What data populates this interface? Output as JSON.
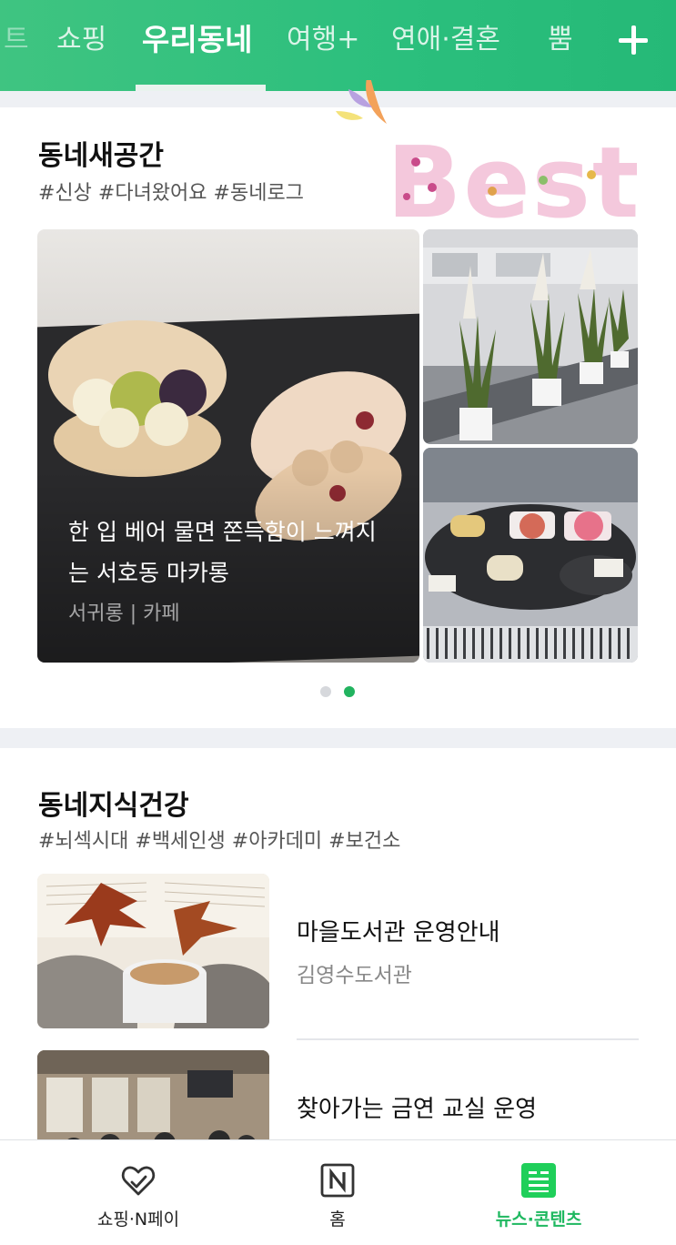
{
  "colors": {
    "brand_green": "#2bbf7d",
    "active_green": "#1fb860",
    "dot_inactive": "#d6d8dc"
  },
  "top_tabs": [
    {
      "label": "트",
      "state": "partial"
    },
    {
      "label": "쇼핑",
      "state": "normal"
    },
    {
      "label": "우리동네",
      "state": "active"
    },
    {
      "label": "여행+",
      "state": "normal"
    },
    {
      "label": "연애·결혼",
      "state": "normal"
    },
    {
      "label": "뿜",
      "state": "normal"
    }
  ],
  "top_plus_icon": "plus-icon",
  "sticker": {
    "text": "Best"
  },
  "section1": {
    "title": "동네새공간",
    "tags": "#신상 #다녀왔어요 #동네로그",
    "feature": {
      "caption": "한 입 베어 물면 쫀득함이 느껴지는 서호동 마카롱",
      "meta": "서귀롱 | 카페"
    },
    "carousel": {
      "total": 2,
      "active": 2
    }
  },
  "section2": {
    "title": "동네지식건강",
    "tags": "#뇌섹시대 #백세인생 #아카데미 #보건소",
    "items": [
      {
        "title": "마을도서관 운영안내",
        "source": "김영수도서관"
      },
      {
        "title": "찾아가는 금연 교실 운영"
      }
    ]
  },
  "bottom_nav": [
    {
      "label": "쇼핑·N페이",
      "icon": "heart-check-icon",
      "active": false
    },
    {
      "label": "홈",
      "icon": "n-logo-icon",
      "active": false
    },
    {
      "label": "뉴스·콘텐츠",
      "icon": "news-icon",
      "active": true
    }
  ]
}
